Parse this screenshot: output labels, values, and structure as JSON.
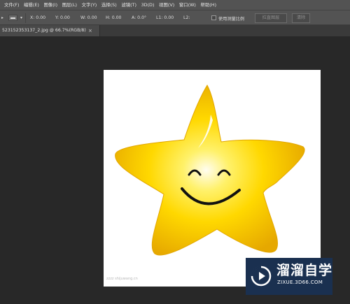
{
  "menubar": {
    "items": [
      "文件(F)",
      "编辑(E)",
      "图像(I)",
      "图层(L)",
      "文字(Y)",
      "选择(S)",
      "滤镜(T)",
      "3D(D)",
      "视图(V)",
      "窗口(W)",
      "帮助(H)"
    ]
  },
  "options": {
    "x": "X:  0.00",
    "y": "Y:  0.00",
    "w": "W:  0.00",
    "h": "H:  0.00",
    "a": "A:  0.0°",
    "l1": "L1:  0.00",
    "l2": "L2:",
    "use_scale": "使用测量比例",
    "straighten_label": "拉直图层",
    "clear_label": "清除"
  },
  "document": {
    "tab_title": "523152353137_2.jpg @ 66.7%(RGB/8)",
    "close_glyph": "×"
  },
  "image": {
    "subject": "smiling yellow star",
    "star_color": "#FFD400",
    "faint_caption": "zzzz  shijuwang.cn"
  },
  "watermark": {
    "name": "溜溜自学",
    "url": "ZIXUE.3D66.COM",
    "bg_color": "#1A3050"
  }
}
